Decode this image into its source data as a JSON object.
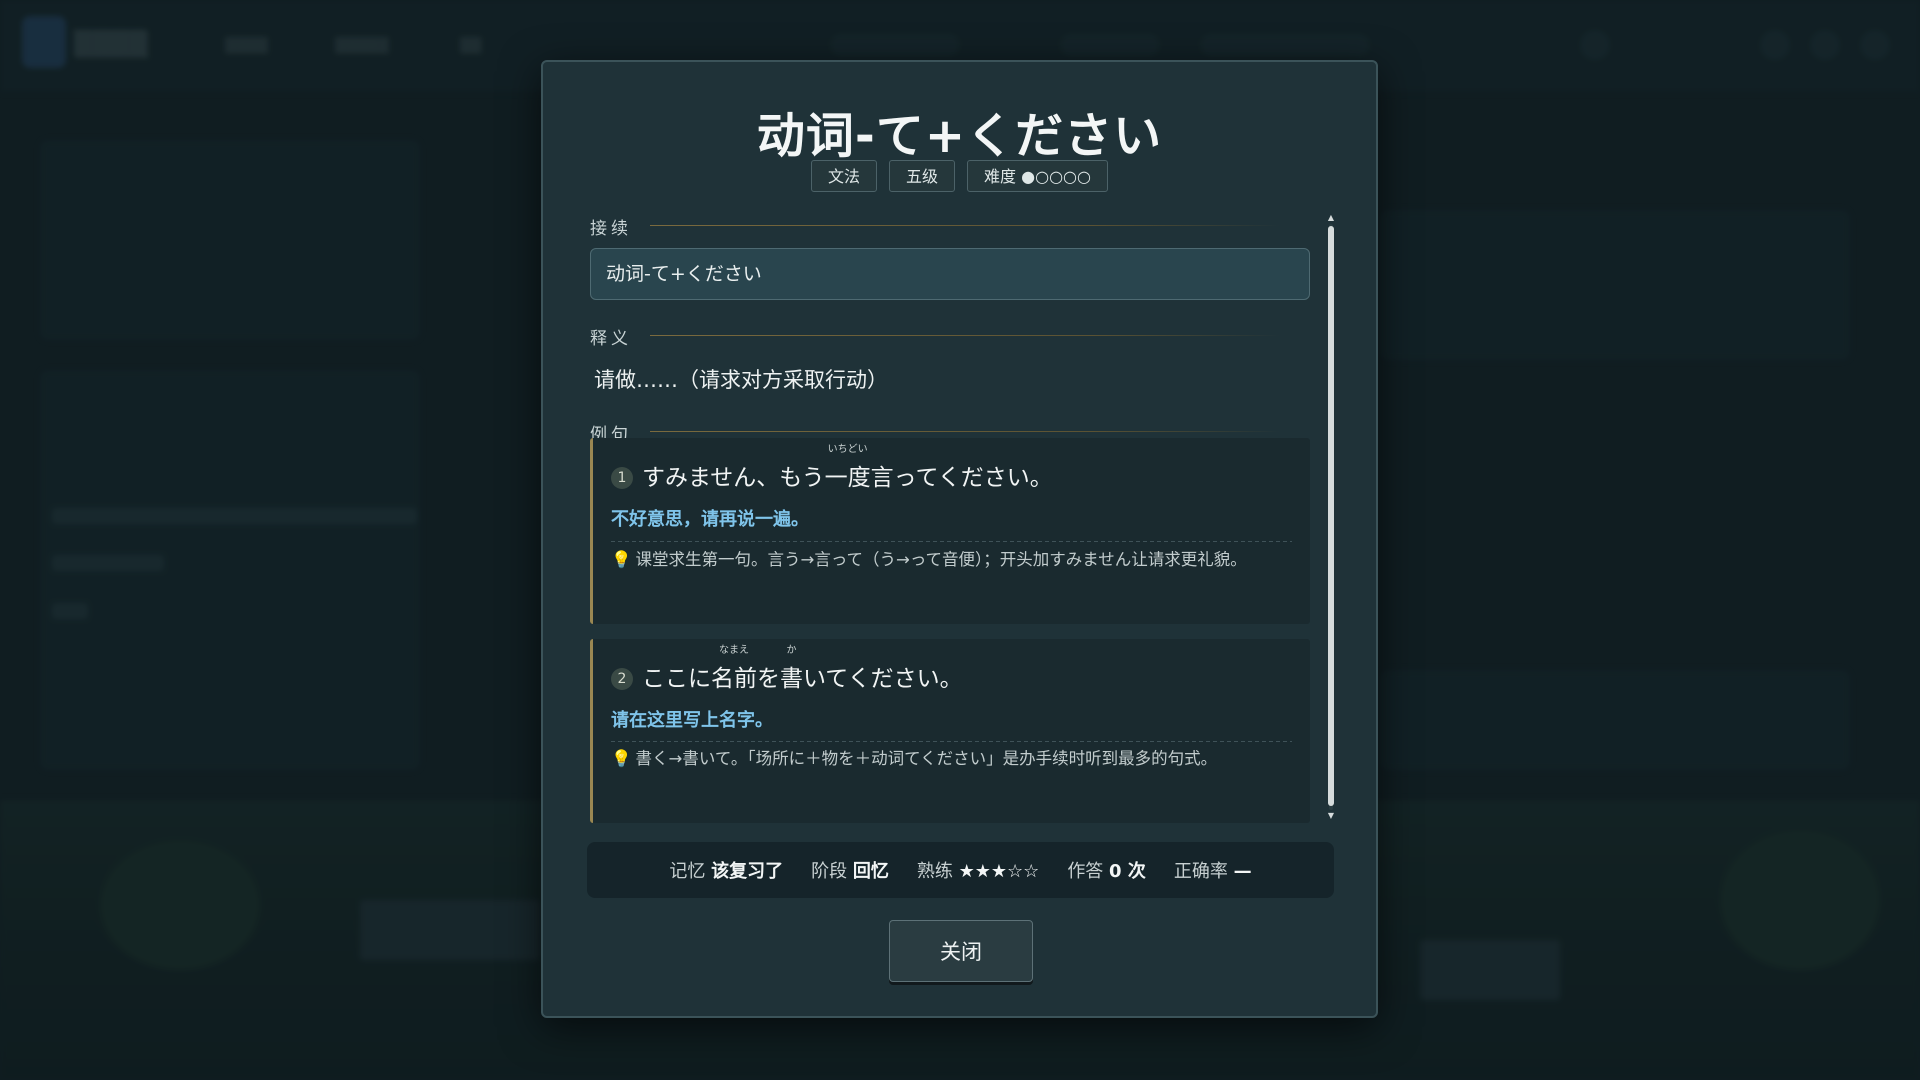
{
  "card": {
    "title": "动词-て+ください",
    "tags": {
      "type": "文法",
      "level": "五级",
      "difficulty_label": "难度",
      "difficulty_level": 1,
      "difficulty_max": 5
    },
    "sections": {
      "connection": {
        "label": "接续",
        "value": "动词-て+ください"
      },
      "meaning": {
        "label": "释义",
        "value": "请做……（请求对方采取行动）"
      },
      "examples_label": "例句"
    },
    "examples": [
      {
        "index": "1",
        "jp_before": "すみません、もう",
        "ruby_base": "一度",
        "ruby_text": "いちどい",
        "jp_mid": "言",
        "jp_after": "ってください。",
        "cn": "不好意思，请再说一遍。",
        "note": "课堂求生第一句。言う→言って（う→って音便）；开头加すみません让请求更礼貌。"
      },
      {
        "index": "2",
        "jp_before": "ここに",
        "ruby_base": "名前",
        "ruby_text": "なまえ",
        "jp_mid": "を",
        "ruby2_base": "書",
        "ruby2_text": "か",
        "jp_after": "いてください。",
        "cn": "请在这里写上名字。",
        "note": "書く→書いて。「场所に＋物を＋动词てください」是办手续时听到最多的句式。"
      }
    ],
    "status": {
      "memory_label": "记忆",
      "memory_value": "该复习了",
      "stage_label": "阶段",
      "stage_value": "回忆",
      "mastery_label": "熟练",
      "mastery_stars": 3,
      "mastery_max": 5,
      "answers_label": "作答",
      "answers_value": "0 次",
      "accuracy_label": "正确率",
      "accuracy_value": "—"
    },
    "close_label": "关闭"
  },
  "colors": {
    "accent_gold": "#9a8752",
    "translation_blue": "#7fc4ea",
    "modal_bg": "#1f3238"
  },
  "icons": {
    "note": "lightbulb-icon"
  }
}
